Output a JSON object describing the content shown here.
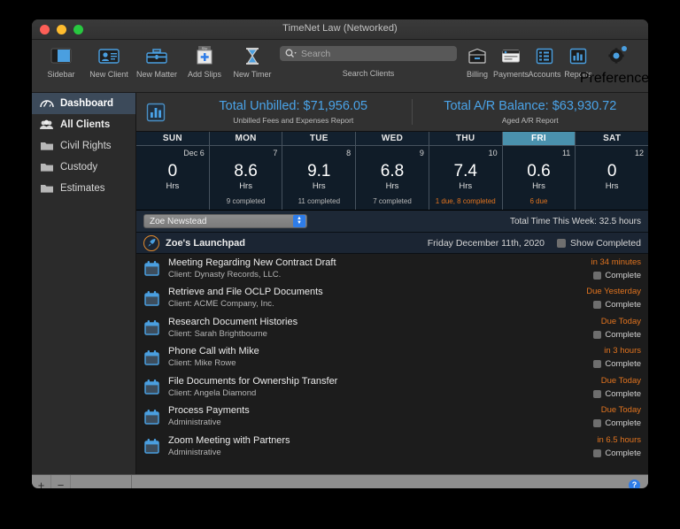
{
  "window": {
    "title": "TimeNet Law (Networked)"
  },
  "toolbar": {
    "left_items": [
      {
        "label": "Sidebar",
        "icon": "sidebar-icon"
      },
      {
        "label": "New Client",
        "icon": "new-client-icon"
      },
      {
        "label": "New Matter",
        "icon": "briefcase-icon"
      },
      {
        "label": "Add Slips",
        "icon": "add-slips-icon"
      },
      {
        "label": "New Timer",
        "icon": "hourglass-icon"
      }
    ],
    "search": {
      "placeholder": "Search",
      "caption": "Search Clients",
      "value": ""
    },
    "right_items": [
      {
        "label": "Billing",
        "icon": "billing-icon"
      },
      {
        "label": "Payments",
        "icon": "payments-card-icon"
      },
      {
        "label": "Accounts",
        "icon": "accounts-list-icon"
      },
      {
        "label": "Reports",
        "icon": "reports-bar-chart-icon"
      }
    ],
    "preferences": {
      "label": "Preferences",
      "icon": "gear-icon"
    }
  },
  "sidebar": {
    "items": [
      {
        "label": "Dashboard",
        "icon": "speedometer-icon",
        "selected": true
      },
      {
        "label": "All Clients",
        "icon": "people-icon",
        "selected": false
      },
      {
        "label": "Civil Rights",
        "icon": "folder-icon",
        "selected": false
      },
      {
        "label": "Custody",
        "icon": "folder-icon",
        "selected": false
      },
      {
        "label": "Estimates",
        "icon": "folder-icon",
        "selected": false
      }
    ]
  },
  "summary": {
    "icon": "bar-chart-icon",
    "unbilled": {
      "headline": "Total Unbilled: $71,956.05",
      "sub": "Unbilled Fees and Expenses Report"
    },
    "ar": {
      "headline": "Total A/R Balance: $63,930.72",
      "sub": "Aged A/R Report"
    }
  },
  "week": {
    "days": [
      {
        "name": "SUN",
        "date": "Dec 6",
        "hours": "0",
        "unit": "Hrs",
        "note": "",
        "note_due": false,
        "today": false
      },
      {
        "name": "MON",
        "date": "7",
        "hours": "8.6",
        "unit": "Hrs",
        "note": "9 completed",
        "note_due": false,
        "today": false
      },
      {
        "name": "TUE",
        "date": "8",
        "hours": "9.1",
        "unit": "Hrs",
        "note": "11 completed",
        "note_due": false,
        "today": false
      },
      {
        "name": "WED",
        "date": "9",
        "hours": "6.8",
        "unit": "Hrs",
        "note": "7 completed",
        "note_due": false,
        "today": false
      },
      {
        "name": "THU",
        "date": "10",
        "hours": "7.4",
        "unit": "Hrs",
        "note": "1 due, 8 completed",
        "note_due": true,
        "today": false
      },
      {
        "name": "FRI",
        "date": "11",
        "hours": "0.6",
        "unit": "Hrs",
        "note": "6 due",
        "note_due": true,
        "today": true
      },
      {
        "name": "SAT",
        "date": "12",
        "hours": "0",
        "unit": "Hrs",
        "note": "",
        "note_due": false,
        "today": false
      }
    ]
  },
  "picker": {
    "selected_user": "Zoe Newstead",
    "total_time": "Total Time This Week: 32.5 hours"
  },
  "launchpad": {
    "icon": "rocket-icon",
    "title": "Zoe's Launchpad",
    "date": "Friday December 11th, 2020",
    "show_completed_label": "Show Completed",
    "show_completed_checked": false,
    "complete_label": "Complete",
    "tasks": [
      {
        "icon": "calendar-icon",
        "title": "Meeting Regarding New Contract Draft",
        "sub": "Client: Dynasty Records, LLC.",
        "due": "in 34 minutes",
        "complete": false
      },
      {
        "icon": "calendar-icon",
        "title": "Retrieve and File OCLP Documents",
        "sub": "Client: ACME Company, Inc.",
        "due": "Due Yesterday",
        "complete": false
      },
      {
        "icon": "calendar-icon",
        "title": "Research Document Histories",
        "sub": "Client: Sarah Brightbourne",
        "due": "Due Today",
        "complete": false
      },
      {
        "icon": "calendar-icon",
        "title": "Phone Call with Mike",
        "sub": "Client: Mike Rowe",
        "due": "in 3 hours",
        "complete": false
      },
      {
        "icon": "calendar-icon",
        "title": "File Documents for Ownership Transfer",
        "sub": "Client: Angela Diamond",
        "due": "Due Today",
        "complete": false
      },
      {
        "icon": "calendar-icon",
        "title": "Process Payments",
        "sub": "Administrative",
        "due": "Due Today",
        "complete": false
      },
      {
        "icon": "calendar-icon",
        "title": "Zoom Meeting with Partners",
        "sub": "Administrative",
        "due": "in 6.5 hours",
        "complete": false
      }
    ]
  },
  "footer": {
    "add_label": "+",
    "remove_label": "−",
    "help_label": "?"
  },
  "colors": {
    "accent_blue": "#4aa3e8",
    "due_orange": "#e2741f",
    "today_teal": "#4a91ad",
    "selection_blue": "#3c4a5a"
  }
}
